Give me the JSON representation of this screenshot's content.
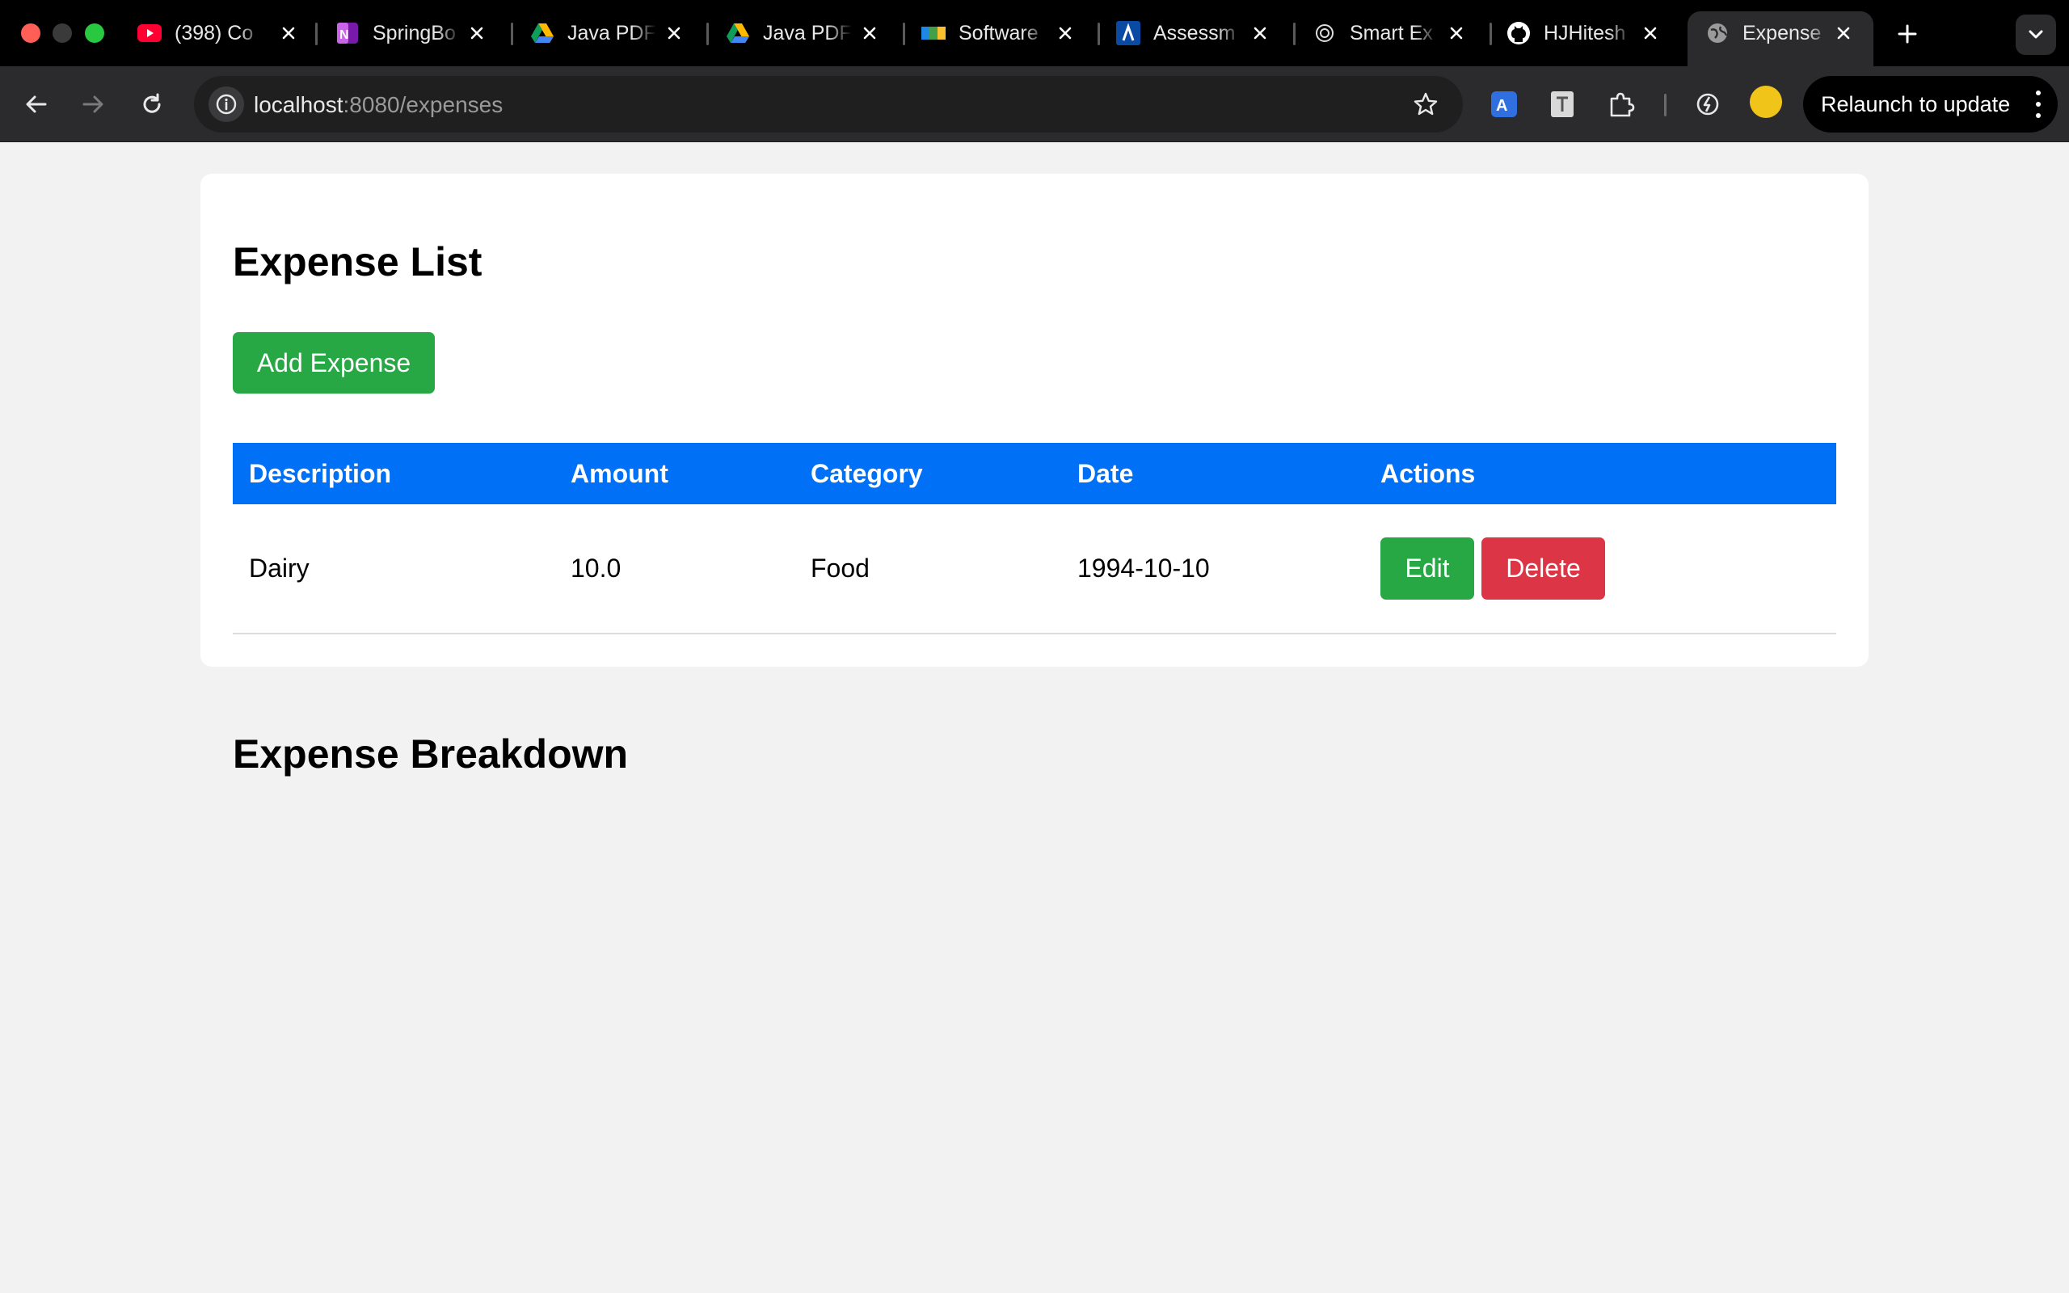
{
  "browser": {
    "tabs": [
      {
        "title": "(398) Co",
        "icon": "youtube-icon"
      },
      {
        "title": "SpringBo",
        "icon": "onenote-icon"
      },
      {
        "title": "Java PDF",
        "icon": "google-drive-icon"
      },
      {
        "title": "Java PDF",
        "icon": "google-drive-icon"
      },
      {
        "title": "Software",
        "icon": "maps-icon"
      },
      {
        "title": "Assessm",
        "icon": "assessment-icon"
      },
      {
        "title": "Smart Ex",
        "icon": "openai-icon"
      },
      {
        "title": "HJHitesh",
        "icon": "github-icon"
      },
      {
        "title": "Expense",
        "icon": "globe-icon"
      }
    ],
    "url_host": "localhost",
    "url_path": ":8080/expenses",
    "relaunch_label": "Relaunch to update"
  },
  "page": {
    "title": "Expense List",
    "add_button": "Add Expense",
    "table": {
      "headers": [
        "Description",
        "Amount",
        "Category",
        "Date",
        "Actions"
      ],
      "rows": [
        {
          "description": "Dairy",
          "amount": "10.0",
          "category": "Food",
          "date": "1994-10-10",
          "edit": "Edit",
          "delete": "Delete"
        }
      ]
    },
    "breakdown_title": "Expense Breakdown"
  },
  "colors": {
    "header_blue": "#0070f7",
    "success_green": "#28a745",
    "danger_red": "#dc3545",
    "page_bg": "#f2f2f2"
  }
}
